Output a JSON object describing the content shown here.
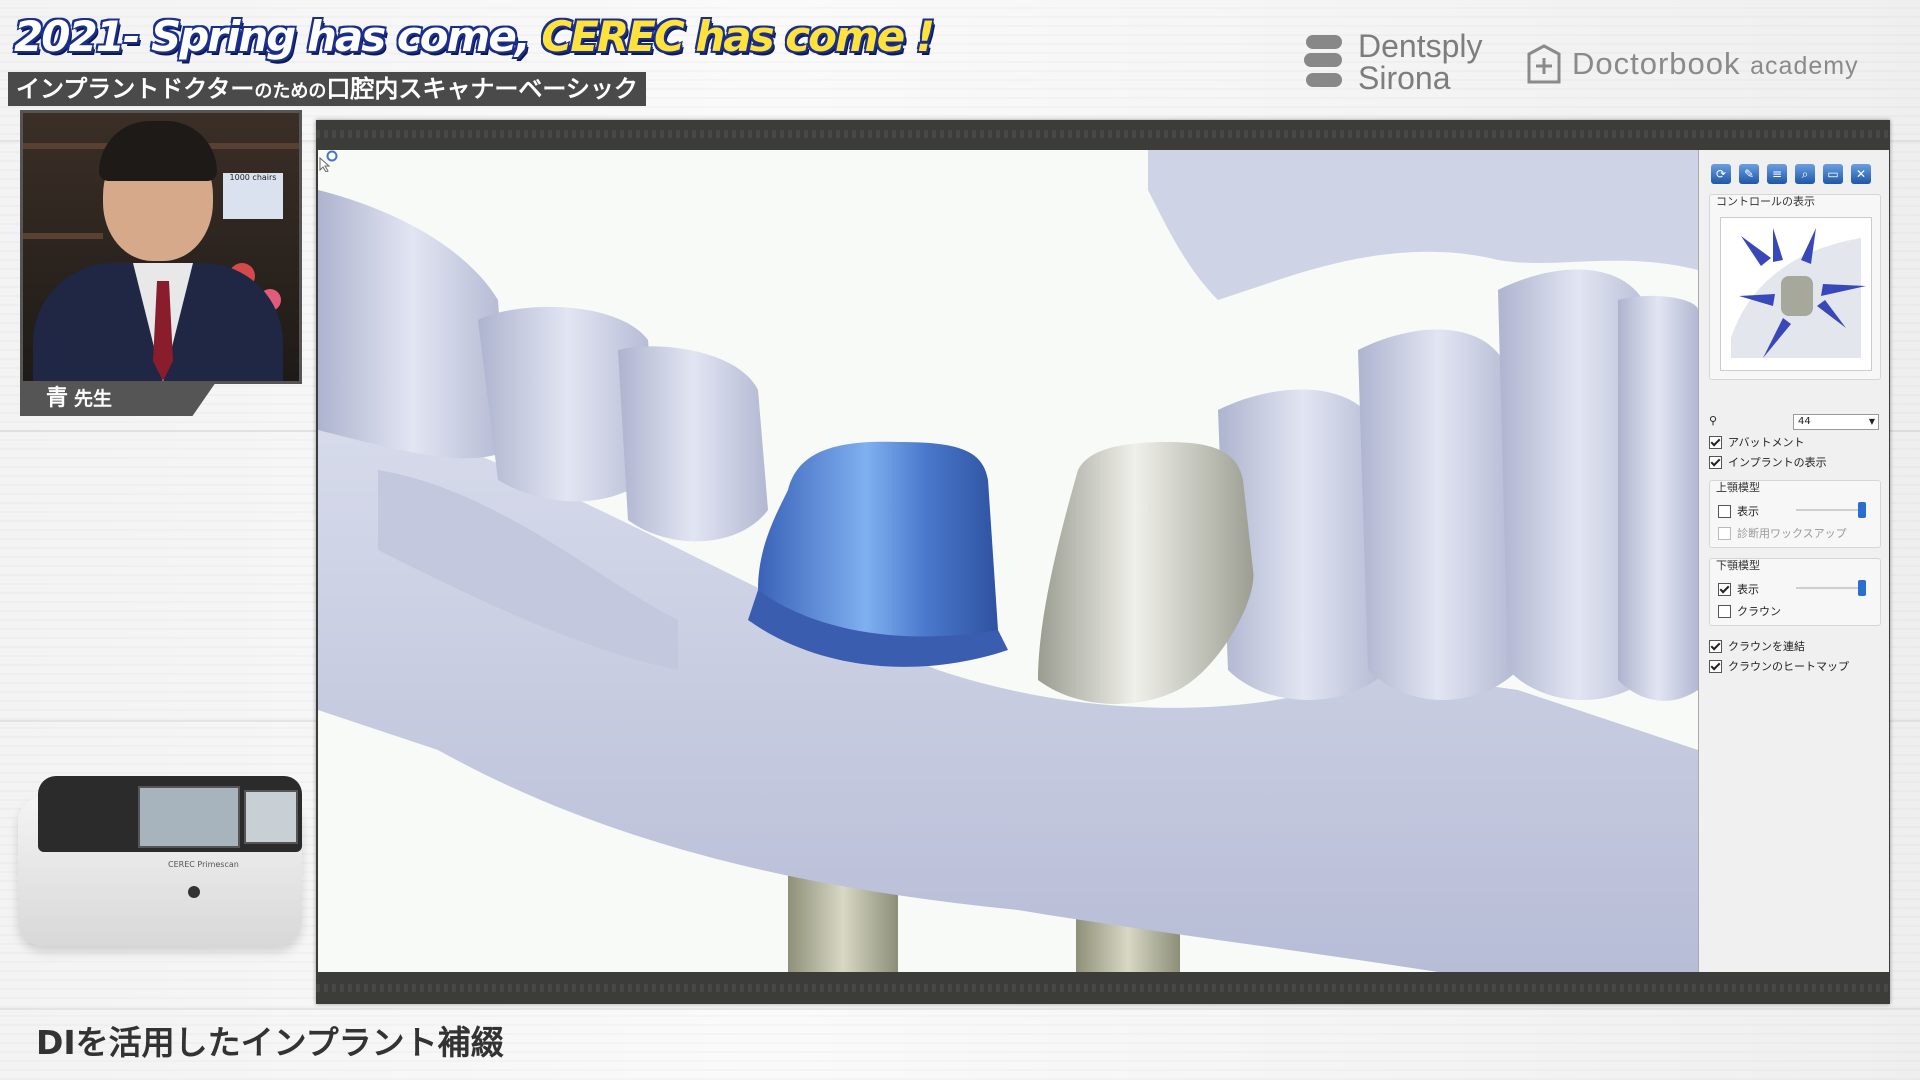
{
  "header": {
    "title_part1": "2021- Spring has come,",
    "title_part2": "CEREC has come !",
    "subtitle_part1": "インプラントドクター",
    "subtitle_part2": "のための",
    "subtitle_part3": "口腔内スキャナーベーシック"
  },
  "logos": {
    "dentsply_line1": "Dentsply",
    "dentsply_line2": "Sirona",
    "doctorbook": "Doctorbook",
    "doctorbook_suffix": "academy"
  },
  "presenter": {
    "name": "青",
    "title": "先生",
    "book_text": "1000 chairs"
  },
  "device": {
    "label": "CEREC Primescan"
  },
  "panel": {
    "section_control_view": "コントロールの表示",
    "tooth_number": "44",
    "abutment": {
      "label": "アバットメント",
      "checked": true
    },
    "implant_view": {
      "label": "インプラントの表示",
      "checked": true
    },
    "upper_model": {
      "title": "上顎模型",
      "show": {
        "label": "表示",
        "checked": false
      },
      "diag_wax": {
        "label": "診断用ワックスアップ",
        "checked": false
      }
    },
    "lower_model": {
      "title": "下顎模型",
      "show": {
        "label": "表示",
        "checked": true
      },
      "crown": {
        "label": "クラウン",
        "checked": false
      }
    },
    "connect_crown": {
      "label": "クラウンを連結",
      "checked": true
    },
    "crown_heatmap": {
      "label": "クラウンのヒートマップ",
      "checked": true
    }
  },
  "caption": "DIを活用したインプラント補綴",
  "colors": {
    "title_outline": "#1a2e8c",
    "title_highlight": "#ffe23b",
    "model_color": "#c8cde2",
    "abutment_blue": "#4a78cc",
    "crown_gray": "#c7c9bd",
    "panel_accent": "#2a6fd0"
  },
  "icons": [
    "rotate-icon",
    "edit-icon",
    "layers-icon",
    "zoom-icon",
    "window-icon",
    "close-icon"
  ]
}
